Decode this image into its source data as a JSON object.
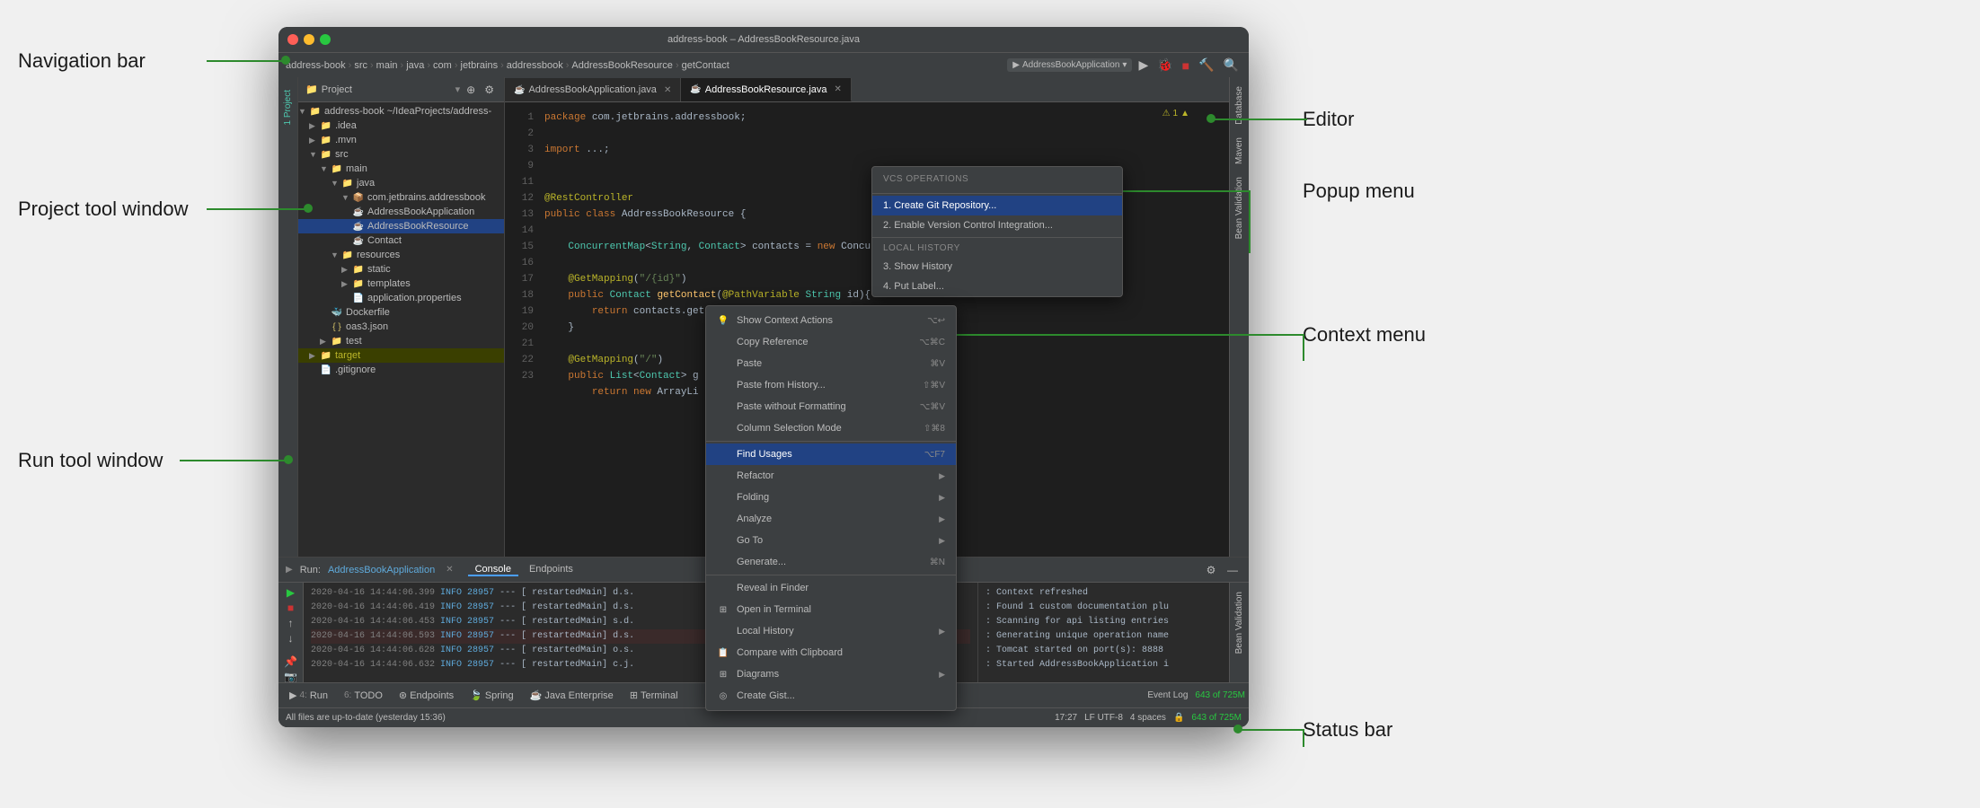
{
  "window": {
    "title": "address-book – AddressBookResource.java",
    "traffic_lights": {
      "red": "close",
      "yellow": "minimize",
      "green": "maximize"
    }
  },
  "annotations": {
    "navigation_bar": "Navigation bar",
    "project_tool_window": "Project tool window",
    "run_tool_window": "Run tool window",
    "editor": "Editor",
    "popup_menu": "Popup menu",
    "context_menu": "Context menu",
    "status_bar": "Status bar"
  },
  "navbar": {
    "project": "address-book",
    "breadcrumbs": [
      "address-book",
      "src",
      "main",
      "java",
      "com",
      "jetbrains",
      "addressbook",
      "AddressBookResource",
      "getContact"
    ],
    "run_config": "AddressBookApplication",
    "buttons": [
      "run",
      "debug",
      "stop",
      "build"
    ]
  },
  "project_panel": {
    "title": "Project",
    "root": "address-book ~/IdeaProjects/address-",
    "items": [
      {
        "name": ".idea",
        "type": "folder",
        "indent": 1
      },
      {
        "name": ".mvn",
        "type": "folder",
        "indent": 1
      },
      {
        "name": "src",
        "type": "folder",
        "indent": 1,
        "expanded": true
      },
      {
        "name": "main",
        "type": "folder",
        "indent": 2,
        "expanded": true
      },
      {
        "name": "java",
        "type": "folder",
        "indent": 3,
        "expanded": true
      },
      {
        "name": "com.jetbrains.addressbook",
        "type": "package",
        "indent": 4
      },
      {
        "name": "AddressBookApplication",
        "type": "java",
        "indent": 5
      },
      {
        "name": "AddressBookResource",
        "type": "java",
        "indent": 5,
        "selected": true
      },
      {
        "name": "Contact",
        "type": "java",
        "indent": 5
      },
      {
        "name": "resources",
        "type": "folder",
        "indent": 3,
        "expanded": true
      },
      {
        "name": "static",
        "type": "folder",
        "indent": 4
      },
      {
        "name": "templates",
        "type": "folder",
        "indent": 4
      },
      {
        "name": "application.properties",
        "type": "file",
        "indent": 4
      },
      {
        "name": "Dockerfile",
        "type": "file",
        "indent": 2
      },
      {
        "name": "oas3.json",
        "type": "json",
        "indent": 2
      },
      {
        "name": "test",
        "type": "folder",
        "indent": 2
      },
      {
        "name": "target",
        "type": "folder",
        "indent": 1,
        "highlighted": true
      },
      {
        "name": ".gitignore",
        "type": "file",
        "indent": 1
      }
    ]
  },
  "editor": {
    "tabs": [
      {
        "name": "AddressBookApplication.java",
        "active": false
      },
      {
        "name": "AddressBookResource.java",
        "active": true
      }
    ],
    "code_lines": [
      {
        "num": 1,
        "text": "package com.jetbrains.addressbook;"
      },
      {
        "num": 2,
        "text": ""
      },
      {
        "num": 3,
        "text": "import ...;"
      },
      {
        "num": 9,
        "text": ""
      },
      {
        "num": 11,
        "text": "@RestController"
      },
      {
        "num": 12,
        "text": "public class AddressBookResource {"
      },
      {
        "num": 13,
        "text": ""
      },
      {
        "num": 14,
        "text": "    ConcurrentMap<String, Contact> contacts = new Concurre"
      },
      {
        "num": 15,
        "text": ""
      },
      {
        "num": 16,
        "text": "    @GetMapping(\"/{id}\")"
      },
      {
        "num": 17,
        "text": "    public Contact getContact(@PathVariable String id){"
      },
      {
        "num": 18,
        "text": "        return contacts.get(id);"
      },
      {
        "num": 19,
        "text": "    }"
      },
      {
        "num": 20,
        "text": ""
      },
      {
        "num": 21,
        "text": "    @GetMapping(\"/\")"
      },
      {
        "num": 22,
        "text": "    public List<Contact> g"
      },
      {
        "num": 23,
        "text": "        return new ArrayLi"
      }
    ]
  },
  "vcs_popup": {
    "title": "VCS Operations",
    "section_local_history": "Local History",
    "items": [
      {
        "label": "1. Create Git Repository...",
        "highlighted": true
      },
      {
        "label": "2. Enable Version Control Integration..."
      },
      {
        "label": "3. Show History"
      },
      {
        "label": "4. Put Label..."
      }
    ]
  },
  "context_menu": {
    "items": [
      {
        "label": "Show Context Actions",
        "shortcut": "⌥↩",
        "icon": "💡"
      },
      {
        "label": "Copy Reference",
        "shortcut": "⌥⌘C"
      },
      {
        "label": "Paste",
        "shortcut": "⌘V"
      },
      {
        "label": "Paste from History...",
        "shortcut": "⇧⌘V"
      },
      {
        "label": "Paste without Formatting",
        "shortcut": "⌥⌘V"
      },
      {
        "label": "Column Selection Mode",
        "shortcut": "⇧⌘8"
      },
      {
        "label": "Find Usages",
        "shortcut": "⌥F7",
        "highlighted": true
      },
      {
        "label": "Refactor",
        "submenu": true
      },
      {
        "label": "Folding",
        "submenu": true
      },
      {
        "label": "Analyze",
        "submenu": true
      },
      {
        "label": "Go To",
        "submenu": true
      },
      {
        "label": "Generate...",
        "shortcut": "⌘N"
      },
      {
        "label": "Reveal in Finder"
      },
      {
        "label": "Open in Terminal"
      },
      {
        "label": "Local History",
        "submenu": true
      },
      {
        "label": "Compare with Clipboard",
        "icon": "📋"
      },
      {
        "label": "Diagrams",
        "submenu": true
      },
      {
        "label": "Create Gist..."
      }
    ]
  },
  "run_panel": {
    "title": "AddressBookApplication",
    "tabs": [
      "Console",
      "Endpoints"
    ],
    "active_tab": "Console",
    "log_lines": [
      {
        "date": "2020-04-16 14:44:06.399",
        "level": "INFO",
        "pid": "28957",
        "thread": "restartedMain",
        "text": "d.s."
      },
      {
        "date": "2020-04-16 14:44:06.419",
        "level": "INFO",
        "pid": "28957",
        "thread": "restartedMain",
        "text": "d.s."
      },
      {
        "date": "2020-04-16 14:44:06.453",
        "level": "INFO",
        "pid": "28957",
        "thread": "restartedMain",
        "text": "s.d."
      },
      {
        "date": "2020-04-16 14:44:06.593",
        "level": "INFO",
        "pid": "28957",
        "thread": "restartedMain",
        "text": "d.s."
      },
      {
        "date": "2020-04-16 14:44:06.628",
        "level": "INFO",
        "pid": "28957",
        "thread": "restartedMain",
        "text": "o.s."
      },
      {
        "date": "2020-04-16 14:44:06.632",
        "level": "INFO",
        "pid": "28957",
        "thread": "restartedMain",
        "text": "c.j."
      }
    ],
    "right_lines": [
      ": Context refreshed",
      ": Found 1 custom documentation plu",
      ": Scanning for api listing entries",
      ": Generating unique operation name",
      ": Tomcat started on port(s): 8888",
      ": Started AddressBookApplication i"
    ]
  },
  "bottom_tabs": [
    {
      "num": "4",
      "label": "Run"
    },
    {
      "num": "6",
      "label": "TODO"
    },
    {
      "label": "Endpoints"
    },
    {
      "label": "Spring"
    },
    {
      "label": "Java Enterprise"
    },
    {
      "label": "Terminal"
    }
  ],
  "status_bar": {
    "message": "All files are up-to-date (yesterday 15:36)",
    "position": "17:27",
    "encoding": "LF  UTF-8",
    "indent": "4 spaces",
    "event_log": "Event Log",
    "git": "643 of 725M"
  },
  "right_panels": [
    "Database",
    "Maven",
    "Bean Validation"
  ]
}
